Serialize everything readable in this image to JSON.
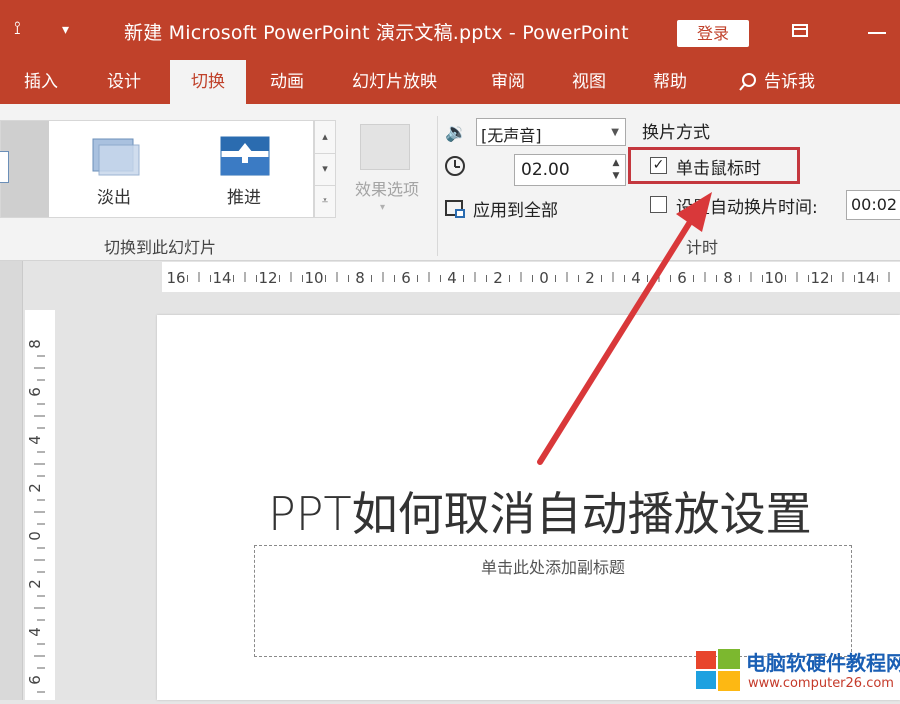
{
  "title_bar": {
    "title": "新建 Microsoft PowerPoint 演示文稿.pptx  -  PowerPoint",
    "login": "登录"
  },
  "tabs": [
    {
      "label": "插入",
      "active": false
    },
    {
      "label": "设计",
      "active": false
    },
    {
      "label": "切换",
      "active": true
    },
    {
      "label": "动画",
      "active": false
    },
    {
      "label": "幻灯片放映",
      "active": false
    },
    {
      "label": "审阅",
      "active": false
    },
    {
      "label": "视图",
      "active": false
    },
    {
      "label": "帮助",
      "active": false
    },
    {
      "label": "告诉我",
      "active": false,
      "icon": "lightbulb-icon"
    }
  ],
  "ribbon": {
    "transitions": {
      "items": [
        "淡出",
        "推进"
      ],
      "effects_label": "效果选项",
      "group_label": "切换到此幻灯片"
    },
    "timing": {
      "sound": "[无声音]",
      "duration": "02.00",
      "apply_all": "应用到全部",
      "advance_heading": "换片方式",
      "on_click_label": "单击鼠标时",
      "on_click_checked": true,
      "after_label": "设置自动换片时间:",
      "after_checked": false,
      "after_value": "00:02",
      "group_label": "计时"
    }
  },
  "ruler": {
    "horizontal": [
      "16",
      "14",
      "12",
      "10",
      "8",
      "6",
      "4",
      "2",
      "0",
      "2",
      "4",
      "6",
      "8",
      "10",
      "12",
      "14"
    ],
    "vertical": [
      "8",
      "6",
      "4",
      "2",
      "0",
      "2",
      "4",
      "6"
    ]
  },
  "slide": {
    "title": "PPT如何取消自动播放设置",
    "subtitle_placeholder": "单击此处添加副标题"
  },
  "watermark": {
    "name": "电脑软硬件教程网",
    "url": "www.computer26.com"
  },
  "colors": {
    "accent": "#c0412a",
    "highlight": "#c4373e",
    "ribbon_bg": "#f3f3f3"
  }
}
